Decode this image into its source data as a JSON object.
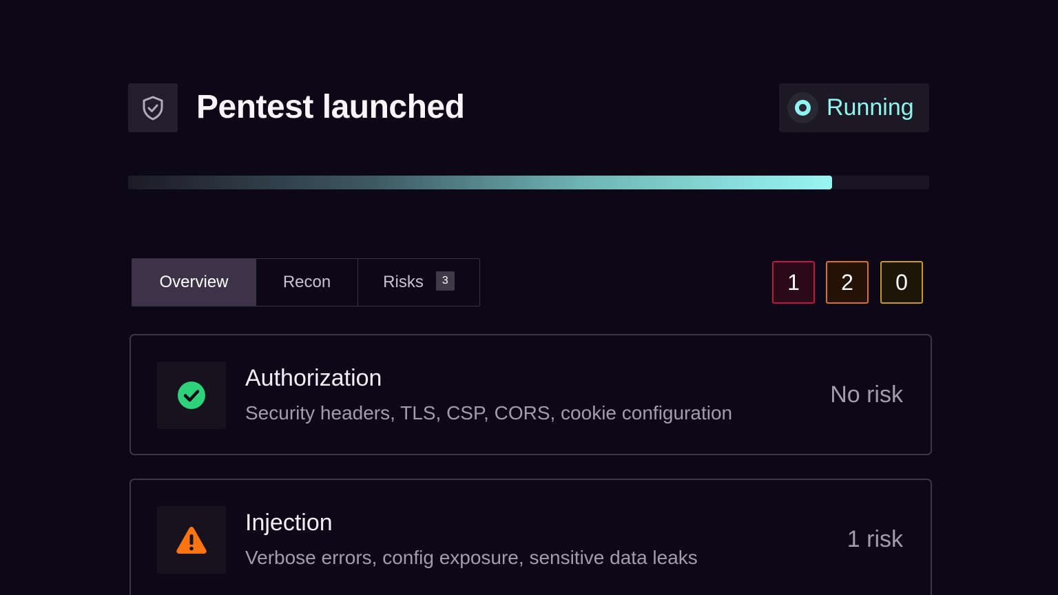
{
  "header": {
    "title": "Pentest launched",
    "icon": "shield-check-icon",
    "status": {
      "label": "Running",
      "color": "#8ff5ee"
    }
  },
  "progress": {
    "fraction": 0.879
  },
  "tabs": [
    {
      "label": "Overview",
      "active": true
    },
    {
      "label": "Recon",
      "active": false
    },
    {
      "label": "Risks",
      "active": false,
      "count": "3"
    }
  ],
  "severity_counts": [
    {
      "value": "1",
      "border": "#c0163f",
      "background": "#2a0a16"
    },
    {
      "value": "2",
      "border": "#d9731c",
      "background": "#241207"
    },
    {
      "value": "0",
      "border": "#c99a1c",
      "background": "#1e1509"
    }
  ],
  "categories": [
    {
      "title": "Authorization",
      "description": "Security headers, TLS, CSP, CORS, cookie configuration",
      "status": "No risk",
      "icon": "check-circle-icon",
      "icon_color": "#2dd27a"
    },
    {
      "title": "Injection",
      "description": "Verbose errors, config exposure, sensitive data leaks",
      "status": "1 risk",
      "icon": "warning-triangle-icon",
      "icon_color": "#ff7412"
    }
  ]
}
